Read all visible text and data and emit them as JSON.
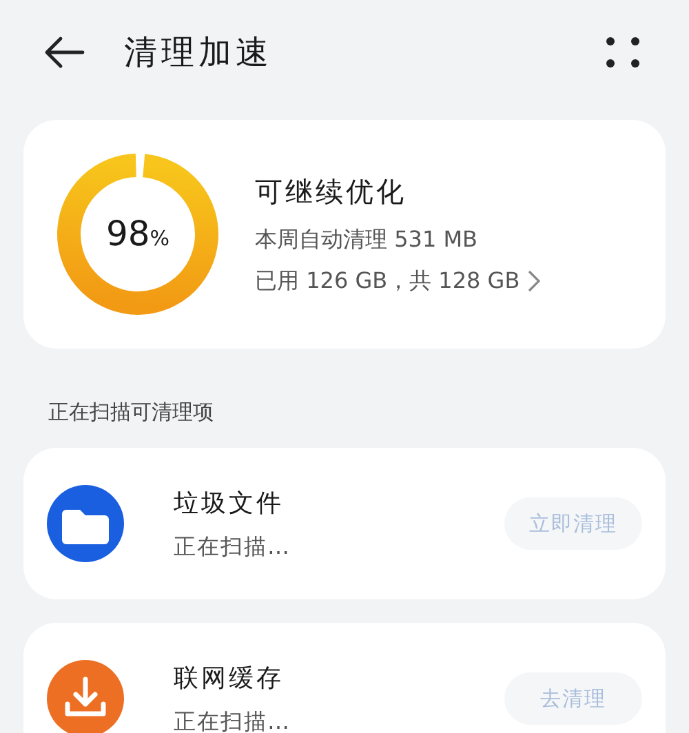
{
  "header": {
    "title": "清理加速"
  },
  "summary": {
    "percent": "98",
    "percent_unit": "%",
    "level": 0.98,
    "status": "可继续优化",
    "weekly": "本周自动清理 531 MB",
    "usage": "已用 126 GB，共 128 GB"
  },
  "section_label": "正在扫描可清理项",
  "items": [
    {
      "kind": "folder",
      "color": "#1a5fe0",
      "title": "垃圾文件",
      "status": "正在扫描…",
      "button": {
        "label": "立即清理",
        "disabled": true
      }
    },
    {
      "kind": "download",
      "color": "#ec6f24",
      "title": "联网缓存",
      "status": "正在扫描…",
      "button": {
        "label": "去清理",
        "disabled": true
      }
    }
  ]
}
